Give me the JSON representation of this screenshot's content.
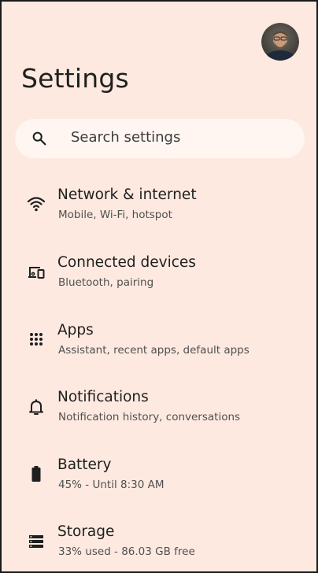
{
  "header": {
    "title": "Settings",
    "avatar_icon": "user-avatar"
  },
  "search": {
    "placeholder": "Search settings",
    "icon": "search-icon"
  },
  "items": [
    {
      "title": "Network & internet",
      "subtitle": "Mobile, Wi-Fi, hotspot",
      "icon": "wifi-icon"
    },
    {
      "title": "Connected devices",
      "subtitle": "Bluetooth, pairing",
      "icon": "connected-devices-icon"
    },
    {
      "title": "Apps",
      "subtitle": "Assistant, recent apps, default apps",
      "icon": "apps-grid-icon"
    },
    {
      "title": "Notifications",
      "subtitle": "Notification history, conversations",
      "icon": "bell-icon"
    },
    {
      "title": "Battery",
      "subtitle": "45% - Until 8:30 AM",
      "icon": "battery-icon"
    },
    {
      "title": "Storage",
      "subtitle": "33% used - 86.03 GB free",
      "icon": "storage-icon"
    }
  ],
  "colors": {
    "background": "#fde9e0",
    "search_background": "#fff6f1",
    "text_primary": "#1f1f1f",
    "text_secondary": "#505050"
  }
}
